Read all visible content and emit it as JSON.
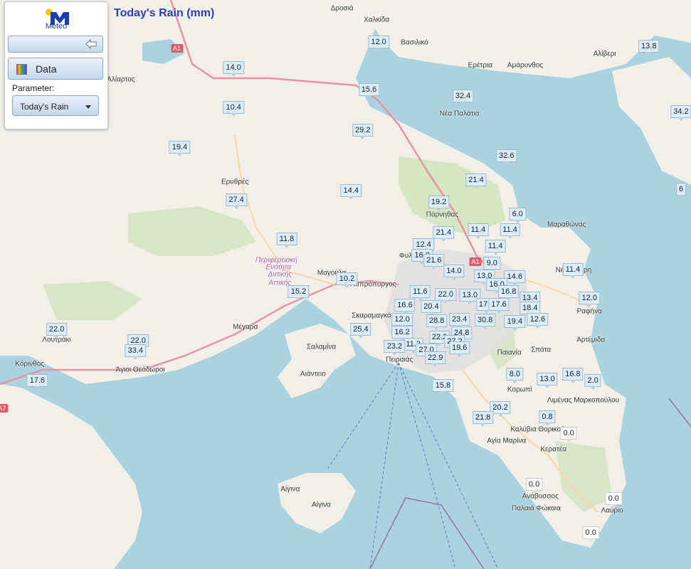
{
  "header": {
    "title": "Today's Rain (mm)"
  },
  "logo": {
    "text": "Meteo",
    "icon": "meteo-logo-icon",
    "colors": {
      "primary": "#1a3fb3",
      "sun": "#f5c518"
    }
  },
  "panel": {
    "back_icon": "back-arrow-icon",
    "data_label": "Data",
    "data_icon": "color-scale-icon",
    "parameter_label": "Parameter:",
    "parameter_value": "Today's Rain"
  },
  "places": [
    {
      "name": "Δροσιά",
      "lat": 0.985,
      "lng": 0.495
    },
    {
      "name": "Χαλκίδα",
      "lat": 0.965,
      "lng": 0.545
    },
    {
      "name": "Βασιλικό",
      "lat": 0.925,
      "lng": 0.6
    },
    {
      "name": "Αλίβερι",
      "lat": 0.905,
      "lng": 0.875
    },
    {
      "name": "Ερέτρια",
      "lat": 0.885,
      "lng": 0.695
    },
    {
      "name": "Αμάρυνθος",
      "lat": 0.885,
      "lng": 0.76
    },
    {
      "name": "Αλίαρτος",
      "lat": 0.86,
      "lng": 0.175
    },
    {
      "name": "Νέα Παλάτια",
      "lat": 0.8,
      "lng": 0.665
    },
    {
      "name": "Ερυθρές",
      "lat": 0.68,
      "lng": 0.34
    },
    {
      "name": "Πάρνηθας",
      "lat": 0.622,
      "lng": 0.64
    },
    {
      "name": "Μαραθώνας",
      "lat": 0.605,
      "lng": 0.82
    },
    {
      "name": "Φυλή",
      "lat": 0.55,
      "lng": 0.59
    },
    {
      "name": "Μαγούλα",
      "lat": 0.52,
      "lng": 0.48
    },
    {
      "name": "Ασπρόπυργος",
      "lat": 0.5,
      "lng": 0.54
    },
    {
      "name": "Νέα Μάκρη",
      "lat": 0.525,
      "lng": 0.83
    },
    {
      "name": "Σκαραμαγκάς",
      "lat": 0.445,
      "lng": 0.54
    },
    {
      "name": "Ραφήνα",
      "lat": 0.452,
      "lng": 0.853
    },
    {
      "name": "Μέγαρα",
      "lat": 0.425,
      "lng": 0.355
    },
    {
      "name": "Λουτράκι",
      "lat": 0.402,
      "lng": 0.082
    },
    {
      "name": "Σαλαμίνα",
      "lat": 0.39,
      "lng": 0.465
    },
    {
      "name": "Αρτέμιδα",
      "lat": 0.402,
      "lng": 0.855
    },
    {
      "name": "Σπάτα",
      "lat": 0.385,
      "lng": 0.783
    },
    {
      "name": "Παιανία",
      "lat": 0.38,
      "lng": 0.737
    },
    {
      "name": "Κόρινθος",
      "lat": 0.36,
      "lng": 0.043
    },
    {
      "name": "Άγιοι Θεόδωροι",
      "lat": 0.35,
      "lng": 0.203
    },
    {
      "name": "Αιάντειο",
      "lat": 0.343,
      "lng": 0.453
    },
    {
      "name": "Κορωπί",
      "lat": 0.315,
      "lng": 0.752
    },
    {
      "name": "Λιμένας Μαρκοπούλου",
      "lat": 0.296,
      "lng": 0.844
    },
    {
      "name": "Καλύβια Θορικού",
      "lat": 0.245,
      "lng": 0.778
    },
    {
      "name": "Κερατέα",
      "lat": 0.21,
      "lng": 0.801
    },
    {
      "name": "Αγία Μαρίνα",
      "lat": 0.225,
      "lng": 0.733
    },
    {
      "name": "Αίγινα",
      "lat": 0.14,
      "lng": 0.42
    },
    {
      "name": "Αίγινα",
      "lat": 0.113,
      "lng": 0.465
    },
    {
      "name": "Ανάβυσσος",
      "lat": 0.128,
      "lng": 0.782
    },
    {
      "name": "Παλαιά Φώκαια",
      "lat": 0.106,
      "lng": 0.776
    },
    {
      "name": "Λαύριο",
      "lat": 0.103,
      "lng": 0.886
    },
    {
      "name": "Πειραιάς",
      "lat": 0.367,
      "lng": 0.578
    }
  ],
  "regions": [
    {
      "name": "Περιφερειακή",
      "lat": 0.543,
      "lng": 0.4
    },
    {
      "name": "Ενότητα",
      "lat": 0.53,
      "lng": 0.403
    },
    {
      "name": "Δυτικής",
      "lat": 0.517,
      "lng": 0.405
    },
    {
      "name": "Αττικής",
      "lat": 0.503,
      "lng": 0.405
    }
  ],
  "roads": [
    {
      "label": "A1",
      "lat": 0.915,
      "lng": 0.256
    },
    {
      "label": "A1",
      "lat": 0.54,
      "lng": 0.688
    },
    {
      "label": "A7",
      "lat": 0.282,
      "lng": 0.003
    }
  ],
  "stations": [
    {
      "value": "14.0",
      "lat": 0.87,
      "lng": 0.338
    },
    {
      "value": "12.0",
      "lat": 0.915,
      "lng": 0.548
    },
    {
      "value": "13.8",
      "lat": 0.908,
      "lng": 0.939
    },
    {
      "value": "15.6",
      "lat": 0.831,
      "lng": 0.534
    },
    {
      "value": "32.4",
      "lat": 0.82,
      "lng": 0.67
    },
    {
      "value": "10.4",
      "lat": 0.8,
      "lng": 0.338
    },
    {
      "value": "34.2",
      "lat": 0.793,
      "lng": 0.988
    },
    {
      "value": "29.2",
      "lat": 0.76,
      "lng": 0.525
    },
    {
      "value": "19.4",
      "lat": 0.73,
      "lng": 0.26
    },
    {
      "value": "32.6",
      "lat": 0.715,
      "lng": 0.733
    },
    {
      "value": "21.4",
      "lat": 0.673,
      "lng": 0.689
    },
    {
      "value": "14.4",
      "lat": 0.654,
      "lng": 0.508
    },
    {
      "value": "6",
      "lat": 0.656,
      "lng": 0.998
    },
    {
      "value": "27.4",
      "lat": 0.638,
      "lng": 0.342
    },
    {
      "value": "19.2",
      "lat": 0.634,
      "lng": 0.635
    },
    {
      "value": "6.0",
      "lat": 0.612,
      "lng": 0.749
    },
    {
      "value": "11.4",
      "lat": 0.585,
      "lng": 0.692
    },
    {
      "value": "11.4",
      "lat": 0.585,
      "lng": 0.738
    },
    {
      "value": "21.4",
      "lat": 0.58,
      "lng": 0.642
    },
    {
      "value": "11.8",
      "lat": 0.569,
      "lng": 0.415
    },
    {
      "value": "12.4",
      "lat": 0.559,
      "lng": 0.613
    },
    {
      "value": "11.4",
      "lat": 0.556,
      "lng": 0.717
    },
    {
      "value": "16.0",
      "lat": 0.54,
      "lng": 0.611
    },
    {
      "value": "21.6",
      "lat": 0.531,
      "lng": 0.628
    },
    {
      "value": "9.0",
      "lat": 0.526,
      "lng": 0.712
    },
    {
      "value": "11.4",
      "lat": 0.515,
      "lng": 0.829
    },
    {
      "value": "14.0",
      "lat": 0.512,
      "lng": 0.657
    },
    {
      "value": "13.0",
      "lat": 0.504,
      "lng": 0.701
    },
    {
      "value": "14.6",
      "lat": 0.502,
      "lng": 0.745
    },
    {
      "value": "10.2",
      "lat": 0.499,
      "lng": 0.502
    },
    {
      "value": "16.0",
      "lat": 0.489,
      "lng": 0.719
    },
    {
      "value": "11.6",
      "lat": 0.476,
      "lng": 0.608
    },
    {
      "value": "16.8",
      "lat": 0.476,
      "lng": 0.736
    },
    {
      "value": "15.2",
      "lat": 0.476,
      "lng": 0.432
    },
    {
      "value": "13.0",
      "lat": 0.47,
      "lng": 0.68
    },
    {
      "value": "22.0",
      "lat": 0.471,
      "lng": 0.645
    },
    {
      "value": "13.4",
      "lat": 0.465,
      "lng": 0.767
    },
    {
      "value": "12.0",
      "lat": 0.465,
      "lng": 0.853
    },
    {
      "value": "17.6",
      "lat": 0.454,
      "lng": 0.704
    },
    {
      "value": "17.6",
      "lat": 0.454,
      "lng": 0.722
    },
    {
      "value": "16.6",
      "lat": 0.452,
      "lng": 0.586
    },
    {
      "value": "20.4",
      "lat": 0.45,
      "lng": 0.624
    },
    {
      "value": "18.4",
      "lat": 0.447,
      "lng": 0.767
    },
    {
      "value": "23.4",
      "lat": 0.428,
      "lng": 0.665
    },
    {
      "value": "12.6",
      "lat": 0.428,
      "lng": 0.778
    },
    {
      "value": "12.0",
      "lat": 0.428,
      "lng": 0.582
    },
    {
      "value": "28.8",
      "lat": 0.425,
      "lng": 0.632
    },
    {
      "value": "30.8",
      "lat": 0.426,
      "lng": 0.702
    },
    {
      "value": "19.4",
      "lat": 0.424,
      "lng": 0.745
    },
    {
      "value": "25.4",
      "lat": 0.41,
      "lng": 0.522
    },
    {
      "value": "16.2",
      "lat": 0.405,
      "lng": 0.582
    },
    {
      "value": "24.8",
      "lat": 0.404,
      "lng": 0.668
    },
    {
      "value": "22.2",
      "lat": 0.396,
      "lng": 0.636
    },
    {
      "value": "27.2",
      "lat": 0.389,
      "lng": 0.658
    },
    {
      "value": "11.2",
      "lat": 0.384,
      "lng": 0.598
    },
    {
      "value": "23.2",
      "lat": 0.38,
      "lng": 0.571
    },
    {
      "value": "19.6",
      "lat": 0.378,
      "lng": 0.665
    },
    {
      "value": "27.0",
      "lat": 0.374,
      "lng": 0.617
    },
    {
      "value": "22.0",
      "lat": 0.39,
      "lng": 0.2
    },
    {
      "value": "22.0",
      "lat": 0.41,
      "lng": 0.082
    },
    {
      "value": "33.4",
      "lat": 0.373,
      "lng": 0.196
    },
    {
      "value": "22.9",
      "lat": 0.36,
      "lng": 0.63
    },
    {
      "value": "8.0",
      "lat": 0.331,
      "lng": 0.745
    },
    {
      "value": "16.8",
      "lat": 0.331,
      "lng": 0.829
    },
    {
      "value": "13.0",
      "lat": 0.322,
      "lng": 0.792
    },
    {
      "value": "2.0",
      "lat": 0.32,
      "lng": 0.858
    },
    {
      "value": "17.6",
      "lat": 0.32,
      "lng": 0.054
    },
    {
      "value": "15.8",
      "lat": 0.311,
      "lng": 0.641
    },
    {
      "value": "20.2",
      "lat": 0.272,
      "lng": 0.724
    },
    {
      "value": "21.8",
      "lat": 0.255,
      "lng": 0.699
    },
    {
      "value": "0.8",
      "lat": 0.256,
      "lng": 0.792
    },
    {
      "value": "0.0",
      "lat": 0.228,
      "lng": 0.823
    },
    {
      "value": "0.0",
      "lat": 0.138,
      "lng": 0.773
    },
    {
      "value": "0.0",
      "lat": 0.112,
      "lng": 0.888
    },
    {
      "value": "0.0",
      "lat": 0.052,
      "lng": 0.855
    }
  ]
}
